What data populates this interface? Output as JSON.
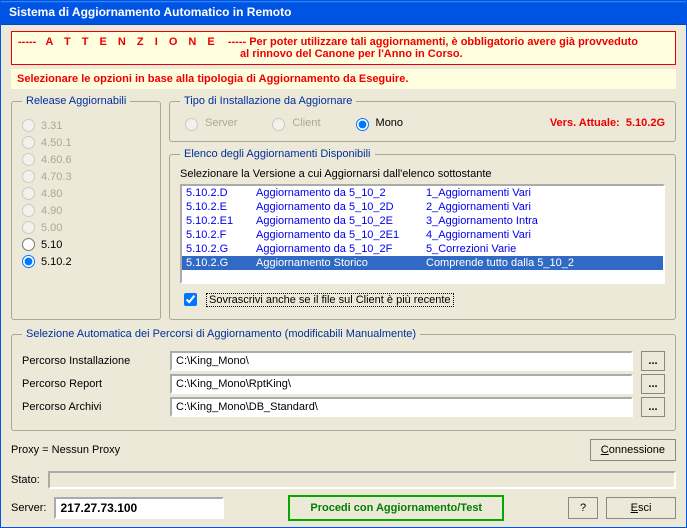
{
  "window": {
    "title": "Sistema di Aggiornamento Automatico in Remoto"
  },
  "warning": {
    "dashes": "-----",
    "attention": "A T T E N Z I O N E",
    "body1": "Per poter utilizzare tali aggiornamenti, è obbligatorio avere già provveduto",
    "body2": "al rinnovo del Canone per l'Anno in Corso."
  },
  "select_hint": "Selezionare le opzioni in base alla tipologia di Aggiornamento da Eseguire.",
  "releases": {
    "legend": "Release Aggiornabili",
    "items": [
      {
        "label": "3.31",
        "enabled": false,
        "checked": false
      },
      {
        "label": "4.50.1",
        "enabled": false,
        "checked": false
      },
      {
        "label": "4.60.6",
        "enabled": false,
        "checked": false
      },
      {
        "label": "4.70.3",
        "enabled": false,
        "checked": false
      },
      {
        "label": "4.80",
        "enabled": false,
        "checked": false
      },
      {
        "label": "4.90",
        "enabled": false,
        "checked": false
      },
      {
        "label": "5.00",
        "enabled": false,
        "checked": false
      },
      {
        "label": "5.10",
        "enabled": true,
        "checked": false
      },
      {
        "label": "5.10.2",
        "enabled": true,
        "checked": true
      }
    ]
  },
  "tipo": {
    "legend": "Tipo di Installazione da Aggiornare",
    "server": "Server",
    "client": "Client",
    "mono": "Mono",
    "vers_label": "Vers. Attuale:",
    "vers_value": "5.10.2G"
  },
  "elenco": {
    "legend": "Elenco degli Aggiornamenti Disponibili",
    "instr": "Selezionare la Versione a cui Aggiornarsi dall'elenco sottostante",
    "rows": [
      {
        "v": "5.10.2.D",
        "desc": "Aggiornamento da 5_10_2",
        "note": "1_Aggiornamenti Vari",
        "sel": false
      },
      {
        "v": "5.10.2.E",
        "desc": "Aggiornamento da 5_10_2D",
        "note": "2_Aggiornamenti Vari",
        "sel": false
      },
      {
        "v": "5.10.2.E1",
        "desc": "Aggiornamento da 5_10_2E",
        "note": "3_Aggiornamento Intra",
        "sel": false
      },
      {
        "v": "5.10.2.F",
        "desc": "Aggiornamento da 5_10_2E1",
        "note": "4_Aggiornamenti Vari",
        "sel": false
      },
      {
        "v": "5.10.2.G",
        "desc": "Aggiornamento da 5_10_2F",
        "note": "5_Correzioni Varie",
        "sel": false
      },
      {
        "v": "5.10.2.G",
        "desc": "Aggiornamento Storico",
        "note": "Comprende tutto dalla 5_10_2",
        "sel": true
      }
    ],
    "overwrite_label": "Sovrascrivi anche se il file sul Client è più recente"
  },
  "paths": {
    "legend": "Selezione Automatica dei Percorsi di Aggiornamento (modificabili Manualmente)",
    "install_lbl": "Percorso Installazione",
    "install_val": "C:\\King_Mono\\",
    "report_lbl": "Percorso Report",
    "report_val": "C:\\King_Mono\\RptKing\\",
    "archivi_lbl": "Percorso Archivi",
    "archivi_val": "C:\\King_Mono\\DB_Standard\\",
    "browse": "..."
  },
  "bottom": {
    "proxy": "Proxy = Nessun Proxy",
    "connessione": "Connessione",
    "stato_lbl": "Stato:",
    "server_lbl": "Server:",
    "server_val": "217.27.73.100",
    "procedi": "Procedi con Aggiornamento/Test",
    "help": "?",
    "esci": "Esci"
  }
}
